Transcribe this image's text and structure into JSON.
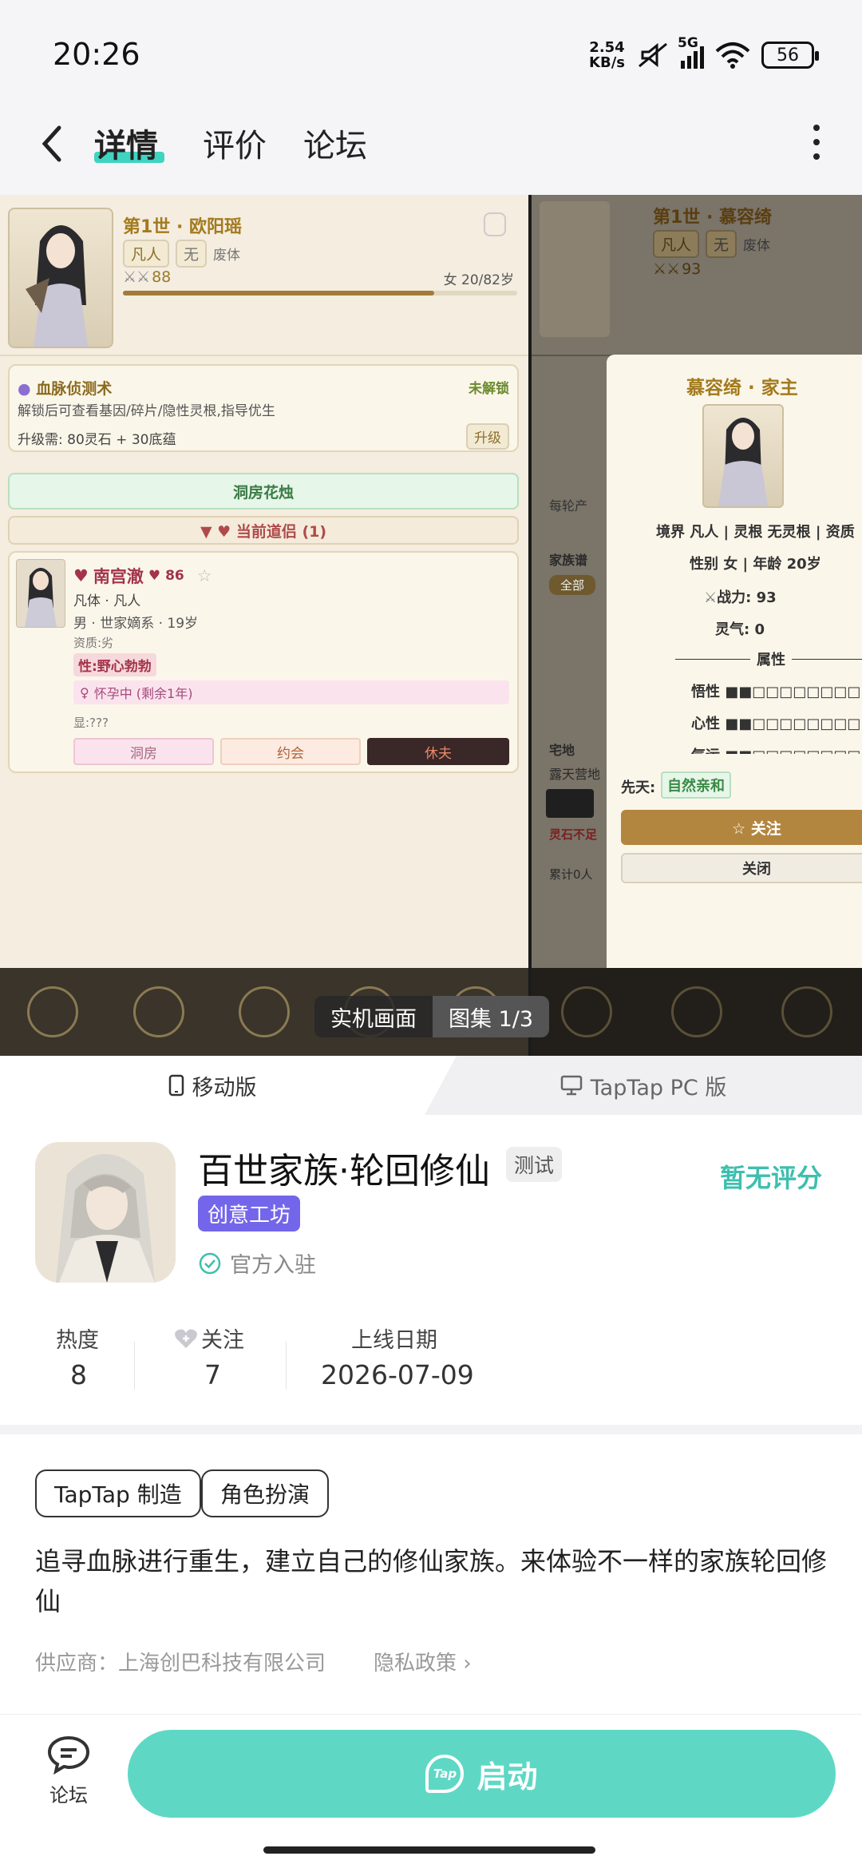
{
  "status_bar": {
    "time": "20:26",
    "net_speed_value": "2.54",
    "net_speed_unit": "KB/s",
    "network": "5G",
    "battery": "56"
  },
  "nav": {
    "tabs": [
      {
        "label": "详情"
      },
      {
        "label": "评价"
      },
      {
        "label": "论坛"
      }
    ]
  },
  "gallery": {
    "badge_left": "实机画面",
    "badge_right": "图集 1/3",
    "shot1": {
      "char_title": "第1世 · 欧阳瑶",
      "tag1": "凡人",
      "tag2": "无",
      "tag3": "废体",
      "power": "88",
      "gender_age": "女 20/82岁",
      "progress": 0.79,
      "skill_title": "血脉侦测术",
      "skill_status": "未解锁",
      "skill_desc": "解锁后可查看基因/碎片/隐性灵根,指导优生",
      "upgrade_cost": "升级需: 80灵石 + 30底蕴",
      "upgrade_btn": "升级",
      "wedding_btn": "洞房花烛",
      "partner_header": "▼ ♥ 当前道侣 (1)",
      "partner_name": "南宫澈",
      "partner_love": "86",
      "partner_body": "凡体 · 凡人",
      "partner_info": "男 · 世家嫡系 · 19岁",
      "partner_apt": "资质:劣",
      "partner_trait": "性:野心勃勃",
      "partner_preg": "怀孕中 (剩余1年)",
      "partner_show": "显:???",
      "btn_a": "洞房",
      "btn_b": "约会",
      "btn_c": "休夫"
    },
    "shot2": {
      "char_title": "第1世 · 慕容绮",
      "tag1": "凡人",
      "tag2": "无",
      "tag3": "废体",
      "power": "93",
      "popup_title": "慕容绮 · 家主",
      "popup_line1": "境界 凡人 | 灵根 无灵根 | 资质",
      "popup_line2": "性别 女 | 年龄 20岁",
      "popup_power": "战力: 93",
      "popup_qi": "灵气: 0",
      "popup_attr": "属性",
      "attr1": "悟性",
      "attr2": "心性",
      "attr3": "气运",
      "innate_label": "先天:",
      "innate_value": "自然亲和",
      "follow_btn": "☆ 关注",
      "close_btn": "关闭",
      "bg1": "每轮产",
      "bg2": "家族谱",
      "bg3": "全部",
      "bg4": "宅地",
      "bg5": "露天营地",
      "bg6": "灵石不足",
      "bg7": "累计0人"
    }
  },
  "platform": {
    "mobile": "移动版",
    "pc": "TapTap PC 版"
  },
  "app": {
    "title": "百世家族·轮回修仙",
    "test_badge": "测试",
    "rating": "暂无评分",
    "workshop": "创意工坊",
    "official": "官方入驻",
    "stats": [
      {
        "label": "热度",
        "value": "8"
      },
      {
        "label": "关注",
        "value": "7"
      },
      {
        "label": "上线日期",
        "value": "2026-07-09"
      }
    ],
    "tags": [
      "TapTap 制造",
      "角色扮演"
    ],
    "description": "追寻血脉进行重生，建立自己的修仙家族。来体验不一样的家族轮回修仙",
    "supplier": "供应商：上海创巴科技有限公司",
    "privacy": "隐私政策"
  },
  "bottom": {
    "forum": "论坛",
    "launch": "启动",
    "launch_icon": "Tap"
  },
  "colors": {
    "accent": "#5ed8c5",
    "workshop": "#7466ea",
    "rating": "#3dbfae"
  }
}
